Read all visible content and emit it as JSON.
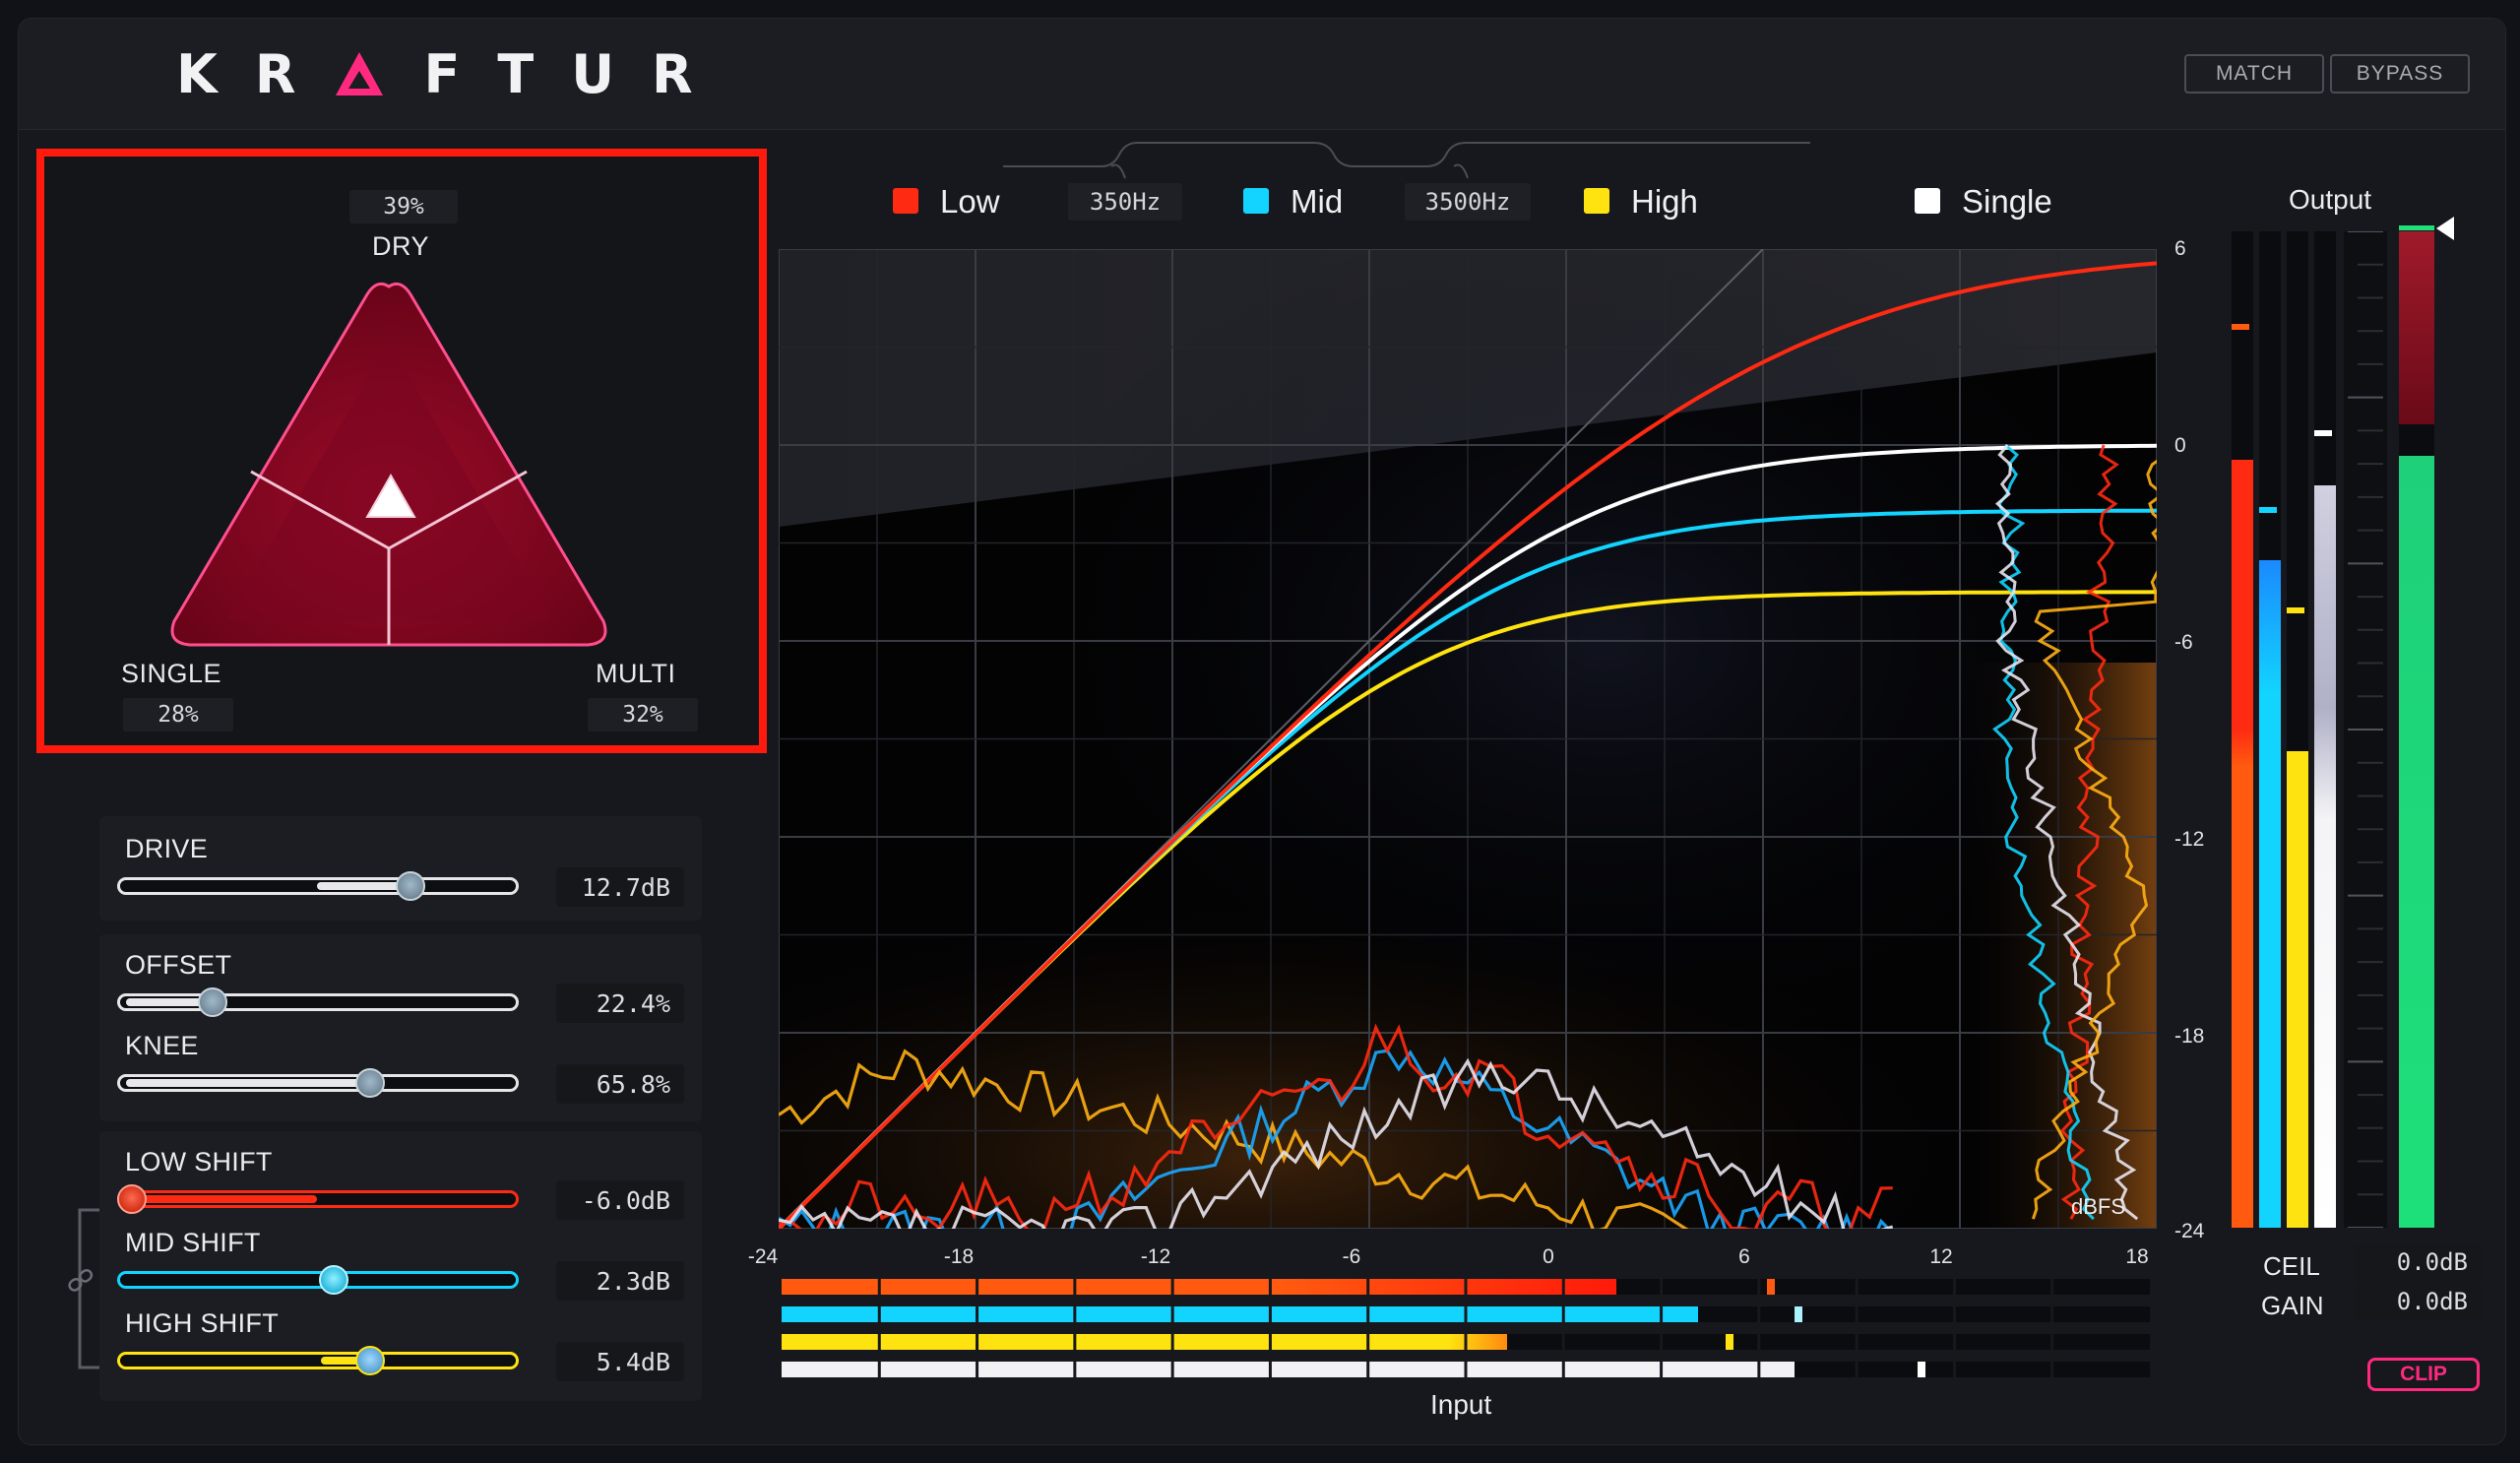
{
  "app": {
    "logo_letters": [
      "K",
      "R",
      "F",
      "T",
      "U",
      "R"
    ],
    "match_label": "MATCH",
    "bypass_label": "BYPASS",
    "accent": "#ff2a7f"
  },
  "mix": {
    "dry_label": "DRY",
    "dry_value": "39%",
    "single_label": "SINGLE",
    "single_value": "28%",
    "multi_label": "MULTI",
    "multi_value": "32%"
  },
  "controls": {
    "drive": {
      "label": "DRIVE",
      "value": "12.7dB",
      "position": 0.76
    },
    "offset": {
      "label": "OFFSET",
      "value": "22.4%",
      "position": 0.22
    },
    "knee": {
      "label": "KNEE",
      "value": "65.8%",
      "position": 0.65
    },
    "low_shift": {
      "label": "LOW SHIFT",
      "value": "-6.0dB",
      "position": 0.0
    },
    "mid_shift": {
      "label": "MID SHIFT",
      "value": "2.3dB",
      "position": 0.55
    },
    "high_shift": {
      "label": "HIGH SHIFT",
      "value": "5.4dB",
      "position": 0.65
    }
  },
  "legend": {
    "low": "Low",
    "freq1": "350Hz",
    "mid": "Mid",
    "freq2": "3500Hz",
    "high": "High",
    "single": "Single"
  },
  "colors": {
    "low": "#ff2a12",
    "mid": "#12d4ff",
    "high": "#ffe310",
    "single": "#ffffff",
    "output_green": "#1ee07a"
  },
  "graph": {
    "x_ticks": [
      "-24",
      "-18",
      "-12",
      "-6",
      "0",
      "6",
      "12",
      "18"
    ],
    "y_ticks": [
      "6",
      "0",
      "-6",
      "-12",
      "-18",
      "-24"
    ],
    "unit_label": "dBFS",
    "input_label": "Input",
    "output_label": "Output"
  },
  "input_meters": {
    "low_level": 0.61,
    "low_peak": 0.72,
    "mid_level": 0.67,
    "mid_peak": 0.74,
    "high_level": 0.53,
    "high_peak": 0.69,
    "single_level": 0.74,
    "single_peak": 0.83
  },
  "output": {
    "ceil_label": "CEIL",
    "ceil_value": "0.0dB",
    "gain_label": "GAIN",
    "gain_value": "0.0dB",
    "clip_label": "CLIP"
  }
}
